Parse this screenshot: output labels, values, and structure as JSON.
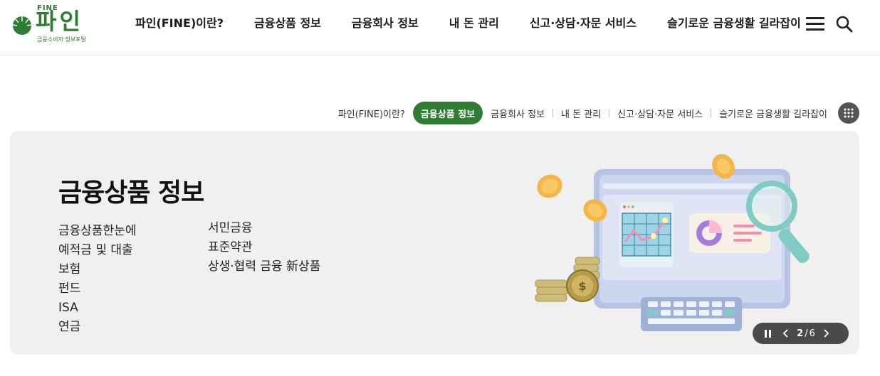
{
  "brand": {
    "logo_top": "FINE",
    "logo_name": "파인",
    "logo_sub": "금융소비자 정보포털",
    "color": "#2e7d32"
  },
  "gnb": {
    "items": [
      {
        "label": "파인(FINE)이란?"
      },
      {
        "label": "금융상품 정보"
      },
      {
        "label": "금융회사 정보"
      },
      {
        "label": "내 돈 관리"
      },
      {
        "label": "신고·상담·자문 서비스"
      },
      {
        "label": "슬기로운 금융생활 길라잡이"
      }
    ],
    "menu_icon": "hamburger-menu-icon",
    "search_icon": "search-icon"
  },
  "subnav": {
    "items": [
      {
        "label": "파인(FINE)이란?"
      },
      {
        "label": "금융상품 정보",
        "active": true
      },
      {
        "label": "금융회사 정보"
      },
      {
        "label": "내 돈 관리"
      },
      {
        "label": "신고·상담·자문 서비스"
      },
      {
        "label": "슬기로운 금융생활 길라잡이"
      }
    ],
    "grid_icon": "grid-menu-icon",
    "active_color": "#2e7d32"
  },
  "banner": {
    "title": "금융상품 정보",
    "links_left": [
      "금융상품한눈에",
      "예적금 및 대출",
      "보험",
      "펀드",
      "ISA",
      "연금"
    ],
    "links_right": [
      "서민금융",
      "표준약관",
      "상생·협력 금융 新상품"
    ],
    "background": "#eff0ef"
  },
  "slider": {
    "current": "2",
    "separator": "/",
    "total": "6",
    "pause_icon": "pause-icon",
    "prev_icon": "chevron-left-icon",
    "next_icon": "chevron-right-icon"
  }
}
